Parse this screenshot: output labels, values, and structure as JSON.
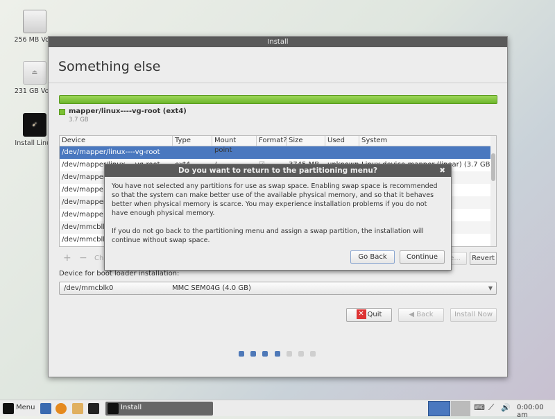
{
  "desktop": {
    "icons": [
      {
        "label": "256 MB Volu"
      },
      {
        "label": "231 GB Volu"
      },
      {
        "label": "Install Linux"
      }
    ]
  },
  "window": {
    "title": "Install",
    "heading": "Something else",
    "partition_bar": {
      "label": "mapper/linux----vg-root (ext4)",
      "size": "3.7 GB",
      "color": "#7cc134"
    },
    "table": {
      "columns": [
        "Device",
        "Type",
        "Mount point",
        "Format?",
        "Size",
        "Used",
        "System"
      ],
      "rows": [
        {
          "device": "/dev/mapper/linux----vg-root",
          "type": "",
          "mount": "",
          "format": "",
          "size": "",
          "used": "",
          "system": "",
          "selected": true
        },
        {
          "device": "  /dev/mapper/linux----vg-root",
          "type": "ext4",
          "mount": "/",
          "format": "checked",
          "size": "3745 MB",
          "used": "unknown",
          "system": "Linux device-mapper (linear) (3.7 GB)"
        },
        {
          "device": "/dev/mapper/",
          "type": "",
          "mount": "",
          "format": "",
          "size": "",
          "used": "",
          "system": ""
        },
        {
          "device": "  /dev/mappe",
          "type": "",
          "mount": "",
          "format": "",
          "size": "",
          "used": "",
          "system": "(230.8 GB)"
        },
        {
          "device": "/dev/mapper/",
          "type": "",
          "mount": "",
          "format": "",
          "size": "",
          "used": "",
          "system": ""
        },
        {
          "device": "  /dev/mappe",
          "type": "",
          "mount": "",
          "format": "",
          "size": "",
          "used": "",
          "system": ""
        },
        {
          "device": "/dev/mmcblk0",
          "type": "",
          "mount": "",
          "format": "",
          "size": "",
          "used": "",
          "system": ""
        },
        {
          "device": "  /dev/mmcblk",
          "type": "",
          "mount": "",
          "format": "",
          "size": "",
          "used": "",
          "system": ""
        }
      ]
    },
    "toolbar": {
      "add": "+",
      "remove": "−",
      "change": "Ch",
      "new_table": "ble...",
      "revert": "Revert"
    },
    "bootloader": {
      "label": "Device for boot loader installation:",
      "device": "/dev/mmcblk0",
      "description": "MMC SEM04G (4.0 GB)"
    },
    "buttons": {
      "quit": "Quit",
      "back": "Back",
      "install": "Install Now"
    },
    "progress": {
      "step": 4,
      "total": 7
    }
  },
  "dialog": {
    "title": "Do you want to return to the partitioning menu?",
    "p1": "You have not selected any partitions for use as swap space. Enabling swap space is recommended so that the system can make better use of the available physical memory, and so that it behaves better when physical memory is scarce. You may experience installation problems if you do not have enough physical memory.",
    "p2": "If you do not go back to the partitioning menu and assign a swap partition, the installation will continue without swap space.",
    "go_back": "Go Back",
    "continue": "Continue"
  },
  "taskbar": {
    "menu": "Menu",
    "task": "Install",
    "clock": "0:00:00 am"
  }
}
